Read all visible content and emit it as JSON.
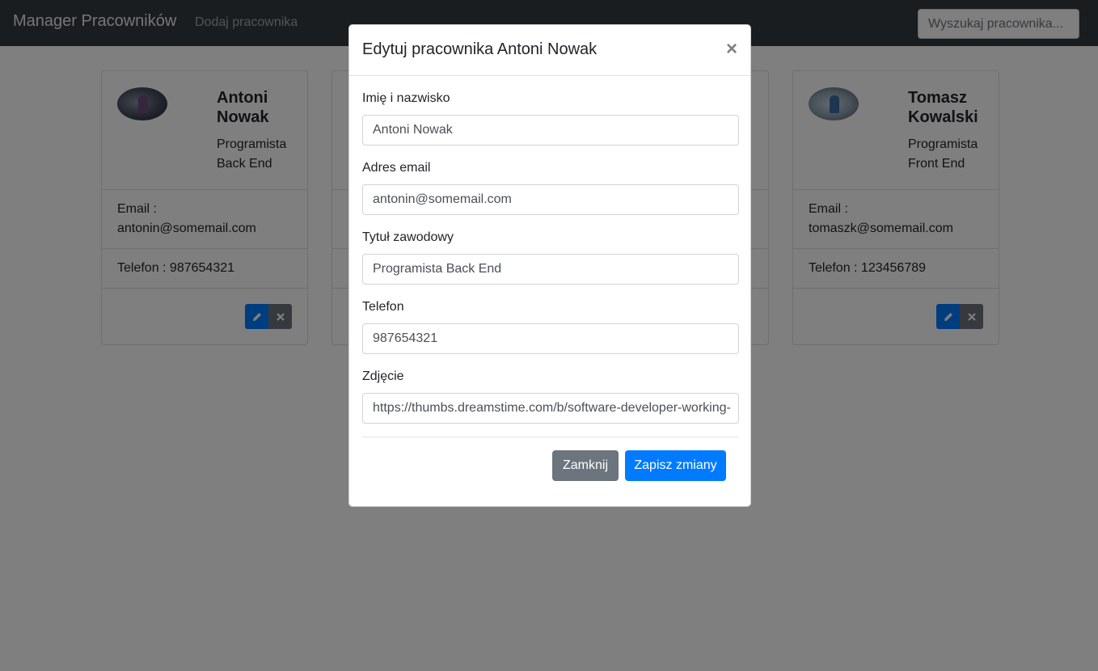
{
  "navbar": {
    "brand": "Manager Pracowników",
    "add_link": "Dodaj pracownika",
    "search_placeholder": "Wyszukaj pracownika..."
  },
  "cards": [
    {
      "name": "Antoni Nowak",
      "role": "Programista Back End",
      "email_label": "Email :",
      "email": "antonin@somemail.com",
      "phone": "Telefon : 987654321"
    },
    {
      "name": "Tomasz Kowalski",
      "role": "Programista Front End",
      "email_label": "Email :",
      "email": "tomaszk@somemail.com",
      "phone": "Telefon : 123456789"
    }
  ],
  "modal": {
    "title": "Edytuj pracownika Antoni Nowak",
    "close_symbol": "×",
    "fields": [
      {
        "label": "Imię i nazwisko",
        "value": "Antoni Nowak"
      },
      {
        "label": "Adres email",
        "value": "antonin@somemail.com"
      },
      {
        "label": "Tytuł zawodowy",
        "value": "Programista Back End"
      },
      {
        "label": "Telefon",
        "value": "987654321"
      },
      {
        "label": "Zdjęcie",
        "value": "https://thumbs.dreamstime.com/b/software-developer-working-"
      }
    ],
    "cancel_label": "Zamknij",
    "save_label": "Zapisz zmiany"
  },
  "colors": {
    "navbar_bg": "#343a40",
    "primary": "#007bff",
    "secondary": "#6c757d"
  },
  "icons": [
    "pencil-icon",
    "x-icon",
    "close-icon"
  ]
}
